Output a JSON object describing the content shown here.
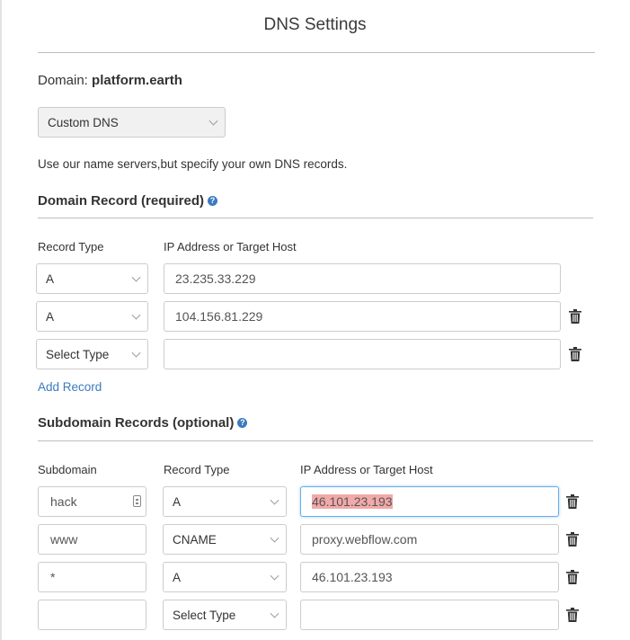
{
  "title": "DNS Settings",
  "domain": {
    "label": "Domain:",
    "value": "platform.earth"
  },
  "dns_mode": {
    "selected": "Custom DNS"
  },
  "description": "Use our name servers,but specify your own DNS records.",
  "domain_records": {
    "heading": "Domain Record (required)",
    "col_type": "Record Type",
    "col_host": "IP Address or Target Host",
    "rows": [
      {
        "type": "A",
        "host": "23.235.33.229"
      },
      {
        "type": "A",
        "host": "104.156.81.229"
      },
      {
        "type": "Select Type",
        "host": ""
      }
    ],
    "add_label": "Add Record"
  },
  "subdomain_records": {
    "heading": "Subdomain Records (optional)",
    "col_sub": "Subdomain",
    "col_type": "Record Type",
    "col_host": "IP Address or Target Host",
    "rows": [
      {
        "subdomain": "hack",
        "type": "A",
        "host": "46.101.23.193"
      },
      {
        "subdomain": "www",
        "type": "CNAME",
        "host": "proxy.webflow.com"
      },
      {
        "subdomain": "*",
        "type": "A",
        "host": "46.101.23.193"
      },
      {
        "subdomain": "",
        "type": "Select Type",
        "host": ""
      }
    ]
  },
  "colors": {
    "link": "#3a7bbf",
    "focus_border": "#66afe9",
    "highlight": "#f2a9a9"
  }
}
